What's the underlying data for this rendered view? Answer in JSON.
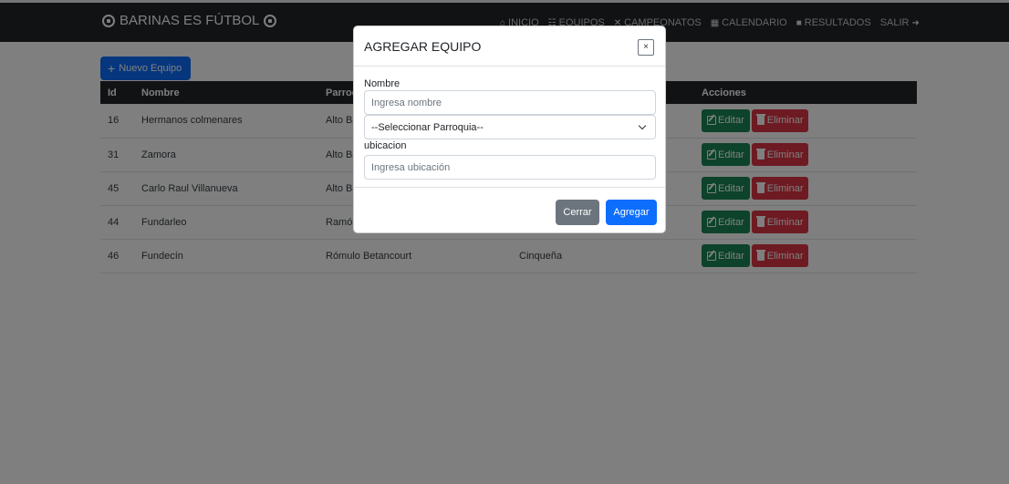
{
  "brand": {
    "text": "BARINAS ES FÚTBOL",
    "icon": "soccer-ball-icon"
  },
  "nav": {
    "items": [
      {
        "label": "INICIO",
        "icon": "home-icon"
      },
      {
        "label": "EQUIPOS",
        "icon": "users-icon"
      },
      {
        "label": "CAMPEONATOS",
        "icon": "trophy-icon"
      },
      {
        "label": "CALENDARIO",
        "icon": "calendar-icon"
      },
      {
        "label": "RESULTADOS",
        "icon": "table-icon"
      },
      {
        "label": "SALIR",
        "icon": "logout-icon"
      }
    ]
  },
  "toolbar": {
    "new_team_label": "Nuevo Equipo"
  },
  "table": {
    "headers": {
      "id": "Id",
      "nombre": "Nombre",
      "parroquia": "Parroquia",
      "ubicacion": "",
      "acciones": "Acciones"
    },
    "rows": [
      {
        "id": "16",
        "nombre": "Hermanos colmenares",
        "parroquia": "Alto Barinas",
        "ubicacion": ""
      },
      {
        "id": "31",
        "nombre": "Zamora",
        "parroquia": "Alto Barinas",
        "ubicacion": ""
      },
      {
        "id": "45",
        "nombre": "Carlo Raul Villanueva",
        "parroquia": "Alto Barinas",
        "ubicacion": ""
      },
      {
        "id": "44",
        "nombre": "Fundarleo",
        "parroquia": "Ramón Ignacio Méndez",
        "ubicacion": ""
      },
      {
        "id": "46",
        "nombre": "Fundecín",
        "parroquia": "Rómulo Betancourt",
        "ubicacion": "Cinqueña"
      }
    ],
    "edit_label": "Editar",
    "delete_label": "Eliminar"
  },
  "modal": {
    "title": "AGREGAR EQUIPO",
    "close_symbol": "×",
    "name_label": "Nombre",
    "name_placeholder": "Ingresa nombre",
    "parish_selected": "--Seleccionar Parroquia--",
    "location_label": "ubicacion",
    "location_placeholder": "Ingresa ubicación",
    "cancel_label": "Cerrar",
    "submit_label": "Agregar"
  },
  "colors": {
    "navbar": "#212529",
    "primary": "#0d6efd",
    "success": "#198754",
    "danger": "#dc3545",
    "secondary": "#6c757d"
  }
}
